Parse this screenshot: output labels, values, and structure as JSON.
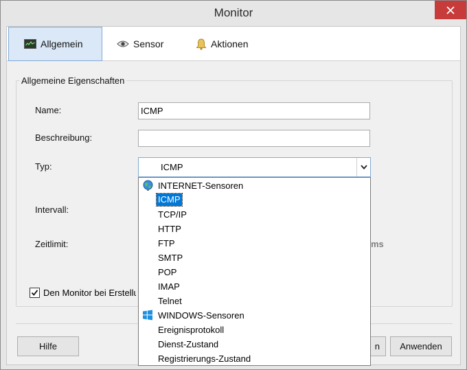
{
  "window": {
    "title": "Monitor"
  },
  "tabs": [
    {
      "label": "Allgemein",
      "icon": "monitor-chart-icon",
      "active": true
    },
    {
      "label": "Sensor",
      "icon": "eye-icon",
      "active": false
    },
    {
      "label": "Aktionen",
      "icon": "bell-icon",
      "active": false
    }
  ],
  "group": {
    "title": "Allgemeine Eigenschaften"
  },
  "form": {
    "name_label": "Name:",
    "name_value": "ICMP",
    "description_label": "Beschreibung:",
    "description_value": "",
    "type_label": "Typ:",
    "type_value": "ICMP",
    "interval_label": "Intervall:",
    "timeout_label": "Zeitlimit:",
    "timeout_unit_partial": "ms",
    "create_checkbox_label": "Den Monitor bei Erstellung",
    "create_checkbox_checked": true
  },
  "dropdown": {
    "items": [
      {
        "label": "INTERNET-Sensoren",
        "icon": "globe-icon",
        "header": true
      },
      {
        "label": "ICMP",
        "selected": true
      },
      {
        "label": "TCP/IP"
      },
      {
        "label": "HTTP"
      },
      {
        "label": "FTP"
      },
      {
        "label": "SMTP"
      },
      {
        "label": "POP"
      },
      {
        "label": "IMAP"
      },
      {
        "label": "Telnet"
      },
      {
        "label": "WINDOWS-Sensoren",
        "icon": "windows-logo-icon",
        "header": true
      },
      {
        "label": "Ereignisprotokoll"
      },
      {
        "label": "Dienst-Zustand"
      },
      {
        "label": "Registrierungs-Zustand"
      }
    ]
  },
  "buttons": {
    "help": "Hilfe",
    "ok_partial": "n",
    "apply": "Anwenden"
  },
  "colors": {
    "accent": "#0078d7",
    "close": "#c73b3b",
    "tab_active_bg": "#dbe8f7"
  }
}
